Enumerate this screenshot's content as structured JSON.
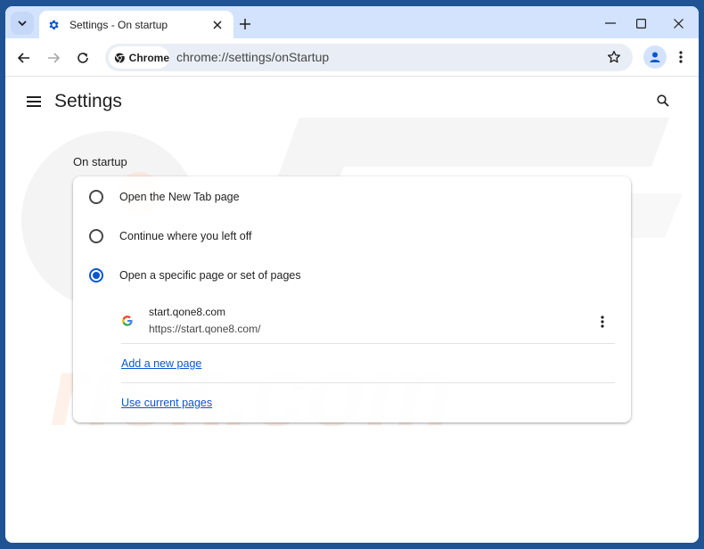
{
  "browser": {
    "tab": {
      "title": "Settings - On startup",
      "favicon": "gear-icon"
    },
    "omnibox": {
      "chip_label": "Chrome",
      "url": "chrome://settings/onStartup"
    },
    "colors": {
      "frame": "#1f5394",
      "tabstrip": "#d3e3fd",
      "accent": "#0b57d0"
    }
  },
  "settings": {
    "title": "Settings",
    "section_title": "On startup",
    "options": [
      {
        "label": "Open the New Tab page",
        "checked": false
      },
      {
        "label": "Continue where you left off",
        "checked": false
      },
      {
        "label": "Open a specific page or set of pages",
        "checked": true
      }
    ],
    "startup_pages": [
      {
        "name": "start.qone8.com",
        "url": "https://start.qone8.com/"
      }
    ],
    "add_page_label": "Add a new page",
    "use_current_label": "Use current pages"
  },
  "watermark": {
    "text": "risk.com",
    "logo": "PC"
  }
}
